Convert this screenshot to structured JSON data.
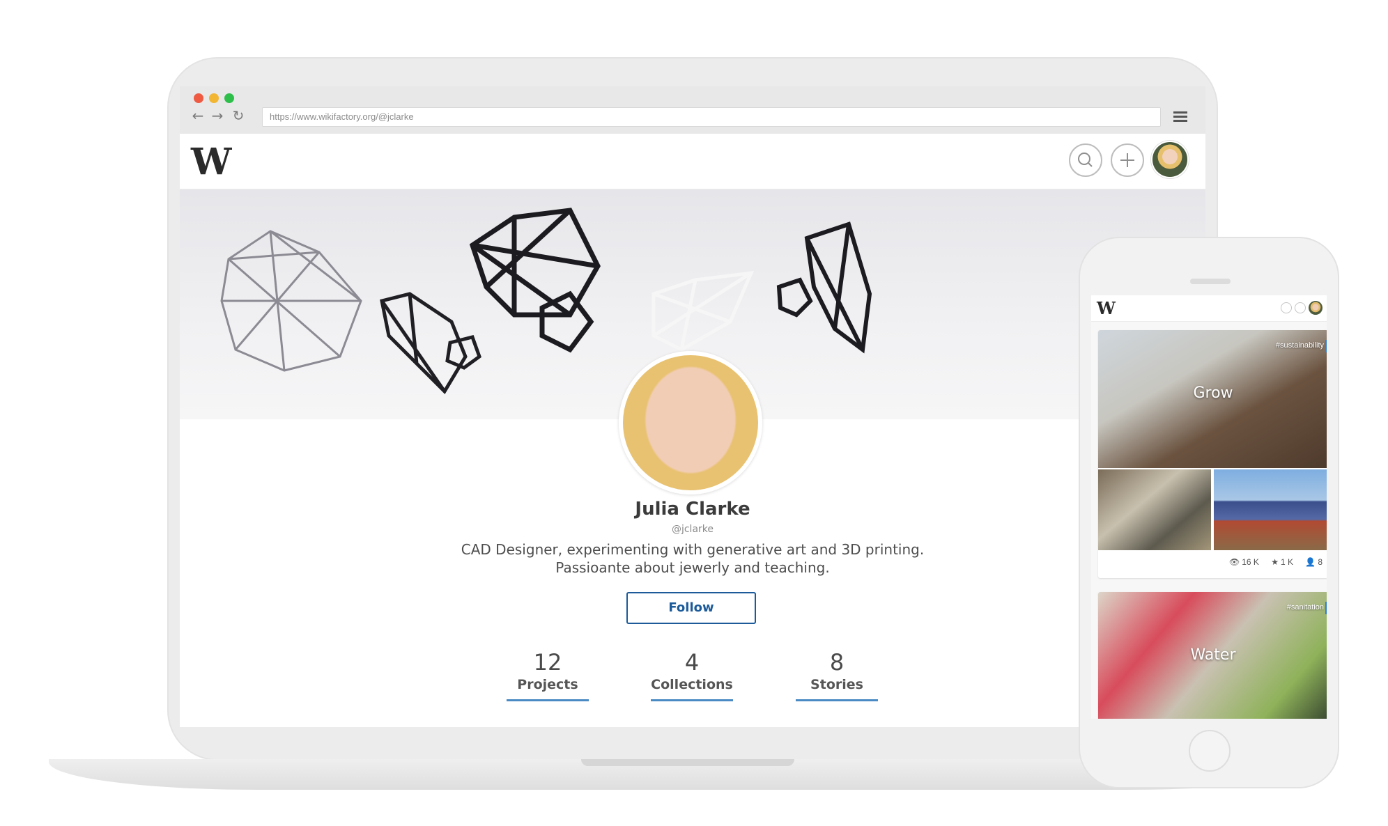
{
  "browser": {
    "url": "https://www.wikifactory.org/@jclarke"
  },
  "site": {
    "logo": "W"
  },
  "profile": {
    "name": "Julia Clarke",
    "handle": "@jclarke",
    "bio": "CAD Designer, experimenting with generative art and 3D printing. Passioante about jewerly and teaching.",
    "follow_label": "Follow",
    "stats": [
      {
        "value": "12",
        "label": "Projects"
      },
      {
        "value": "4",
        "label": "Collections"
      },
      {
        "value": "8",
        "label": "Stories"
      }
    ]
  },
  "mobile": {
    "logo": "W",
    "cards": [
      {
        "title": "Grow",
        "tag": "#sustainability",
        "views": "16 K",
        "stars": "1 K",
        "contributors": "8"
      },
      {
        "title": "Water",
        "tag": "#sanitation"
      }
    ]
  },
  "colors": {
    "accent": "#1c5a99",
    "tab_underline": "#4a8ac4",
    "traffic_red": "#ef5a42",
    "traffic_yellow": "#f2b633",
    "traffic_green": "#2ebf4b"
  },
  "icons": [
    "back-arrow-icon",
    "forward-arrow-icon",
    "reload-icon",
    "menu-icon",
    "search-icon",
    "add-icon",
    "eye-icon",
    "star-icon",
    "person-icon"
  ]
}
